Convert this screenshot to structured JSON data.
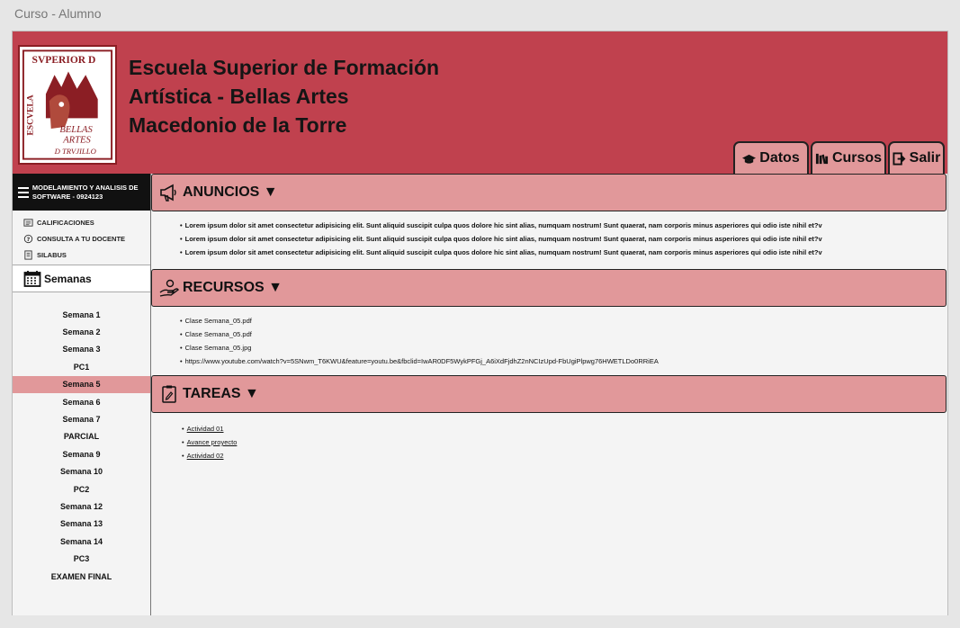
{
  "window": {
    "title": "Curso - Alumno"
  },
  "header": {
    "school_line1": "Escuela Superior de Formación",
    "school_line2": "Artística - Bellas Artes",
    "school_line3": "Macedonio de la Torre",
    "logo_text": "SVPERIOR D ESCVELA BELLAS ARTES D TRVJILLO",
    "tabs": [
      {
        "label": "Datos",
        "icon": "graduation-cap-icon"
      },
      {
        "label": "Cursos",
        "icon": "books-icon"
      },
      {
        "label": "Salir",
        "icon": "sign-out-icon"
      }
    ]
  },
  "sidebar": {
    "course": "MODELAMIENTO Y ANALISIS DE SOFTWARE - 0924123",
    "links": [
      {
        "label": "CALIFICACIONES",
        "icon": "grades-icon"
      },
      {
        "label": "CONSULTA A TU DOCENTE",
        "icon": "question-icon"
      },
      {
        "label": "SILABUS",
        "icon": "syllabus-icon"
      }
    ],
    "weeks_title": "Semanas",
    "weeks": [
      "Semana 1",
      "Semana 2",
      "Semana 3",
      "PC1",
      "Semana 5",
      "Semana 6",
      "Semana 7",
      "PARCIAL",
      "Semana 9",
      "Semana 10",
      "PC2",
      "Semana 12",
      "Semana 13",
      "Semana 14",
      "PC3",
      "EXAMEN FINAL"
    ],
    "active_week": "Semana 5"
  },
  "sections": {
    "announcements": {
      "title": "ANUNCIOS ▼",
      "items": [
        "Lorem ipsum dolor sit amet consectetur adipisicing elit. Sunt aliquid suscipit culpa quos dolore hic sint alias, numquam nostrum! Sunt quaerat, nam corporis minus asperiores qui odio iste nihil et?v",
        "Lorem ipsum dolor sit amet consectetur adipisicing elit. Sunt aliquid suscipit culpa quos dolore hic sint alias, numquam nostrum! Sunt quaerat, nam corporis minus asperiores qui odio iste nihil et?v",
        "Lorem ipsum dolor sit amet consectetur adipisicing elit. Sunt aliquid suscipit culpa quos dolore hic sint alias, numquam nostrum! Sunt quaerat, nam corporis minus asperiores qui odio iste nihil et?v"
      ]
    },
    "resources": {
      "title": "RECURSOS ▼",
      "items": [
        "Clase Semana_05.pdf",
        "Clase Semana_05.pdf",
        "Clase Semana_05.jpg",
        "https://www.youtube.com/watch?v=5SNwm_T6KWU&feature=youtu.be&fbclid=IwAR0DF5WykPFGj_A6iXdFjdhZ2nNCIzUpd-FbUgiPlpwg76HWETLDo0RRiEA"
      ]
    },
    "tasks": {
      "title": "TAREAS ▼",
      "items": [
        "Actividad 01",
        "Avance proyecto",
        "Actividad 02"
      ]
    }
  }
}
